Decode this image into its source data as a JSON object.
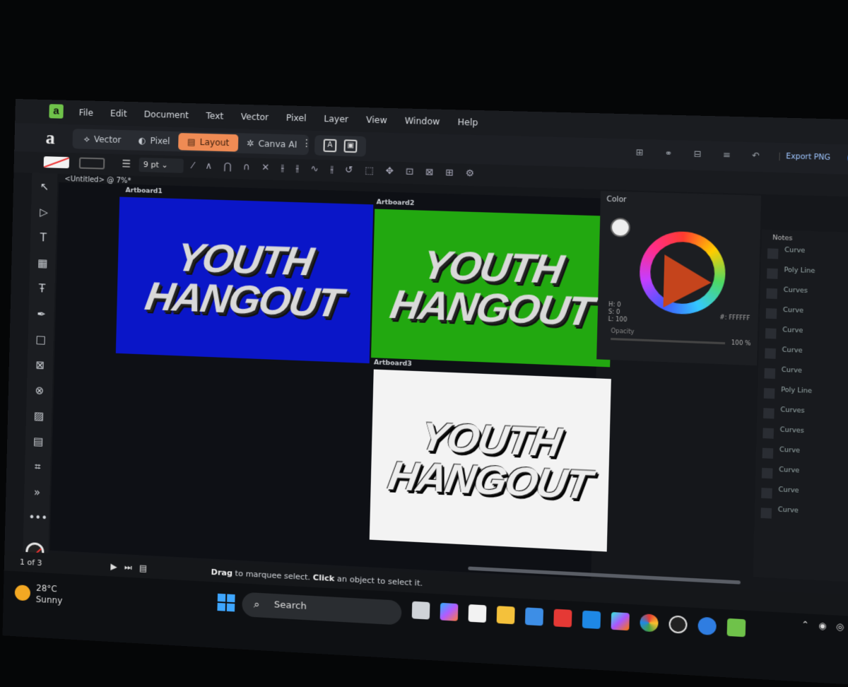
{
  "menu": {
    "items": [
      "File",
      "Edit",
      "Document",
      "Text",
      "Vector",
      "Pixel",
      "Layer",
      "View",
      "Window",
      "Help"
    ]
  },
  "personas": [
    {
      "label": "Vector",
      "icon": "vector-icon"
    },
    {
      "label": "Pixel",
      "icon": "pixel-icon"
    },
    {
      "label": "Layout",
      "icon": "layout-icon",
      "active": true
    },
    {
      "label": "Canva AI",
      "icon": "canva-ai-icon"
    }
  ],
  "toolbar": {
    "stroke_width": "9 pt",
    "export_label": "Export PNG"
  },
  "document": {
    "tab": "<Untitled> @ 7%*"
  },
  "artboards": [
    {
      "label": "Artboard1",
      "bg": "#0a16c8",
      "line1": "YOUTH",
      "line2": "HANGOUT"
    },
    {
      "label": "Artboard2",
      "bg": "#22a810",
      "line1": "YOUTH",
      "line2": "HANGOUT"
    },
    {
      "label": "Artboard3",
      "bg": "#f3f3f3",
      "line1": "YOUTH",
      "line2": "HANGOUT"
    }
  ],
  "color_panel": {
    "tab": "Color",
    "h": "H: 0",
    "s": "S: 0",
    "l": "L: 100",
    "hex": "#: FFFFFF",
    "opacity_label": "Opacity",
    "opacity_value": "100 %"
  },
  "layers_panel": {
    "tab": "Notes",
    "layers": [
      "Curve",
      "Poly Line",
      "Curves",
      "Curve",
      "Curve",
      "Curve",
      "Curve",
      "Poly Line",
      "Curves",
      "Curves",
      "Curve",
      "Curve",
      "Curve",
      "Curve"
    ]
  },
  "status": {
    "pager": "1 of 3",
    "hint_drag": "Drag",
    "hint_mid": " to marquee select. ",
    "hint_click": "Click",
    "hint_end": " an object to select it."
  },
  "taskbar": {
    "temp": "28°C",
    "condition": "Sunny",
    "search_placeholder": "Search"
  },
  "colors": {
    "accent": "#ef8b54",
    "app_green": "#6fc24a"
  }
}
